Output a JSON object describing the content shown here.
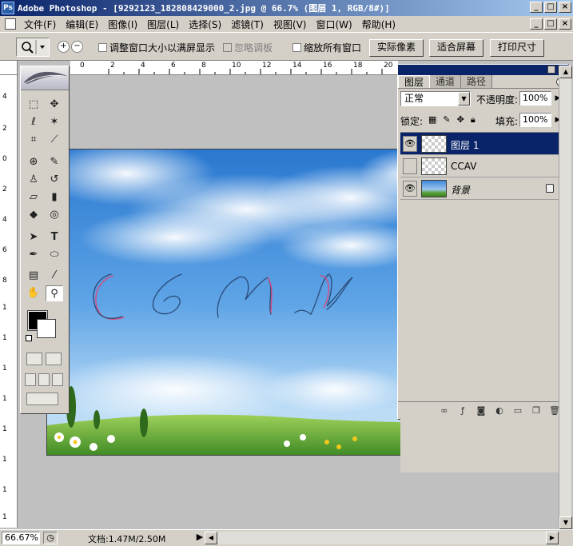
{
  "window": {
    "title": "Adobe Photoshop - [9292123_182808429000_2.jpg @ 66.7% (图层 1, RGB/8#)]",
    "minimize": "_",
    "maximize": "□",
    "close": "×"
  },
  "menu": {
    "items": [
      "文件(F)",
      "编辑(E)",
      "图像(I)",
      "图层(L)",
      "选择(S)",
      "滤镜(T)",
      "视图(V)",
      "窗口(W)",
      "帮助(H)"
    ]
  },
  "options": {
    "zoom_in": "+",
    "zoom_out": "−",
    "resize_window_label": "调整窗口大小以满屏显示",
    "ignore_palettes_label": "忽略调板",
    "zoom_all_windows_label": "缩放所有窗口",
    "actual_pixels": "实际像素",
    "fit_screen": "适合屏幕",
    "print_size": "打印尺寸"
  },
  "rulers": {
    "top": [
      "0",
      "2",
      "4",
      "6",
      "8",
      "10",
      "12",
      "14",
      "16",
      "18",
      "20",
      "22"
    ],
    "left": [
      "4",
      "2",
      "0",
      "2",
      "4",
      "6",
      "8",
      "1",
      "1",
      "1",
      "1",
      "1",
      "1",
      "1",
      "1",
      "2",
      "2",
      "2"
    ]
  },
  "toolbox": {
    "type_tool": "T"
  },
  "layers_panel": {
    "tabs": [
      "图层",
      "通道",
      "路径"
    ],
    "blend_mode": "正常",
    "opacity_label": "不透明度:",
    "opacity": "100%",
    "lock_label": "锁定:",
    "fill_label": "填充:",
    "fill": "100%",
    "layers": [
      {
        "name": "图层 1",
        "visible": true,
        "selected": true,
        "thumb": "transparent"
      },
      {
        "name": "CCAV",
        "visible": false,
        "selected": false,
        "thumb": "transparent"
      },
      {
        "name": "背景",
        "visible": true,
        "selected": false,
        "thumb": "photo",
        "locked": true
      }
    ]
  },
  "canvas": {
    "artwork_text": "CCAV"
  },
  "status": {
    "zoom": "66.67%",
    "doc_info": "文档:1.47M/2.50M"
  },
  "colors": {
    "title_start": "#0a246a",
    "title_end": "#a6caf0",
    "sky_top": "#2f7fd6",
    "grass": "#5aa33a",
    "stroke_blue": "#2a4a78",
    "stroke_red": "#e0457a"
  }
}
